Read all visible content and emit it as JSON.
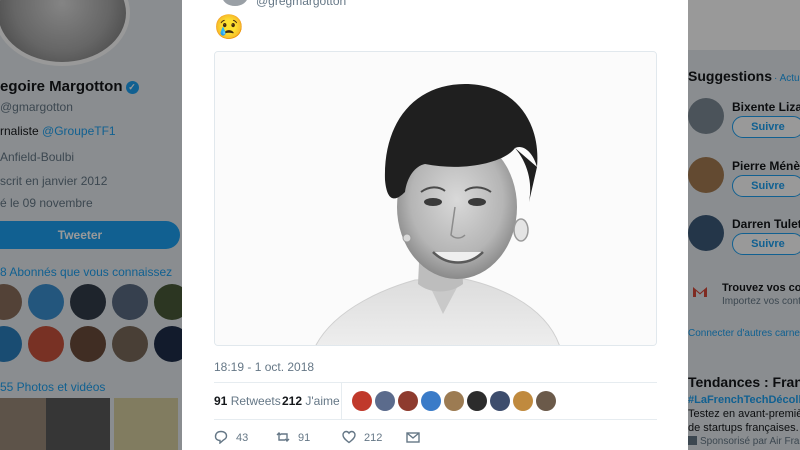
{
  "profile": {
    "name": "egoire Margotton",
    "handle": "@gmargotton",
    "bio_prefix": "rnaliste",
    "bio_link": "@GroupeTF1",
    "location": "Anfield-Boulbi",
    "joined": "scrit en janvier 2012",
    "born": "é le 09 novembre",
    "tweet_button": "Tweeter",
    "followers_known": "8 Abonnés que vous connaissez",
    "photos_videos": "55 Photos et vidéos"
  },
  "tweet": {
    "handle": "@gregmargotton",
    "emoji": "😢",
    "timestamp": "18:19 - 1 oct. 2018",
    "retweets_count": "91",
    "retweets_label": "Retweets",
    "likes_count": "212",
    "likes_label": "J'aime",
    "actions": {
      "reply_count": "43",
      "retweet_count": "91",
      "like_count": "212"
    }
  },
  "suggestions": {
    "title": "Suggestions",
    "refresh": "· Actual",
    "items": [
      {
        "name": "Bixente Lizara",
        "follow": "Suivre"
      },
      {
        "name": "Pierre Ménès",
        "follow": "Suivre"
      },
      {
        "name": "Darren Tulett",
        "follow": "Suivre"
      }
    ],
    "contacts_title": "Trouvez vos co",
    "contacts_sub": "Importez vos contac",
    "connect_link": "Connecter d'autres carnets"
  },
  "trends": {
    "title": "Tendances : Franc",
    "tag": "#LaFrenchTechDécolle",
    "desc_line1": "Testez en avant-premiè",
    "desc_line2": "de startups françaises.",
    "promoted": "Sponsorisé par Air Franc"
  },
  "colors": {
    "accent": "#1da1f2",
    "text": "#14171a",
    "muted": "#657786"
  }
}
